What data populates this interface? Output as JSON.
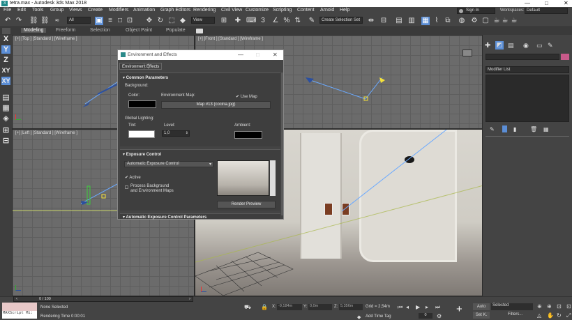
{
  "window": {
    "title": "tetra.max - Autodesk 3ds Max 2018",
    "controls": [
      "—",
      "□",
      "✕"
    ]
  },
  "menu": [
    "File",
    "Edit",
    "Tools",
    "Group",
    "Views",
    "Create",
    "Modifiers",
    "Animation",
    "Graph Editors",
    "Rendering",
    "Civil View",
    "Customize",
    "Scripting",
    "Content",
    "Arnold",
    "Help"
  ],
  "toolbar": {
    "filter": "All",
    "view": "View",
    "selection_set": "Create Selection Set",
    "sign_in": "Sign In",
    "workspaces_label": "Workspaces:",
    "workspace": "Default"
  },
  "ribbon": {
    "tabs": [
      "Modeling",
      "Freeform",
      "Selection",
      "Object Paint",
      "Populate"
    ],
    "active": "Modeling"
  },
  "left_axes": [
    "X",
    "Y",
    "Z",
    "XY",
    "XY"
  ],
  "viewports": {
    "top": "[+] [Top ] [Standard ] [Wireframe ]",
    "front": "[+] [Front ] [Standard ] [Wireframe ]",
    "left": "[+] [Left ] [Standard ] [Wireframe ]"
  },
  "dialog": {
    "title": "Environment and Effects",
    "tabs": [
      "Environment",
      "Effects"
    ],
    "common": {
      "header": "Common Parameters",
      "background": "Background:",
      "color": "Color:",
      "env_map": "Environment Map:",
      "use_map": "Use Map",
      "map_button": "Map #13 (cocina.jpg)",
      "global_lighting": "Global Lighting:",
      "tint": "Tint:",
      "level": "Level:",
      "level_value": "1,0",
      "ambient": "Ambient:"
    },
    "exposure": {
      "header": "Exposure Control",
      "control": "Automatic Exposure Control",
      "active": "Active",
      "process_bg_1": "Process Background",
      "process_bg_2": "and Environment Maps",
      "render_preview": "Render Preview"
    },
    "next_header": "Automatic Exposure Control Parameters"
  },
  "right_panel": {
    "modifier_list": "Modifier List"
  },
  "status": {
    "maxscript": "MAXScript Mi:",
    "none_selected": "None Selected",
    "rendering_time": "Rendering Time  0:00:01",
    "frame": "0 / 100",
    "x_label": "X:",
    "x_value": "-9,184m",
    "y_label": "Y:",
    "y_value": "0,0m",
    "z_label": "Z:",
    "z_value": "5,356m",
    "grid": "Grid = 2,54m",
    "add_time_tag": "Add Time Tag",
    "auto": "Auto",
    "selected": "Selected",
    "set_k": "Set K.",
    "filters": "Filters..."
  },
  "colors": {
    "accent": "#5b8ed6",
    "ui_bg": "#444444",
    "viewport": "#6b6b6b",
    "pink": "#c85a8a"
  }
}
